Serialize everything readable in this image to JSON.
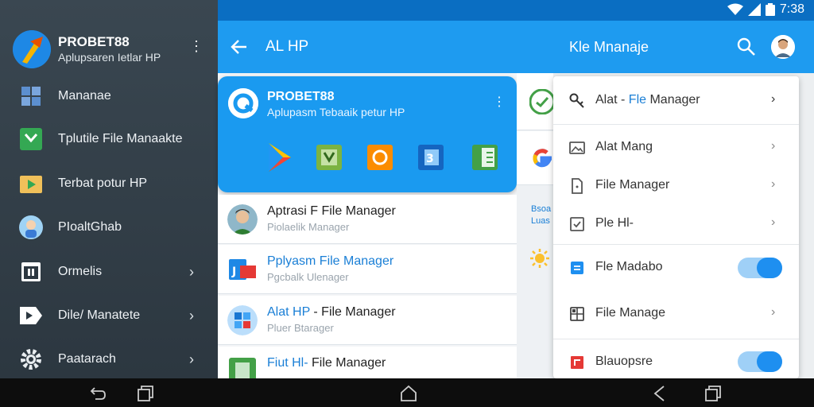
{
  "status_bar": {
    "time": "7:38"
  },
  "drawer": {
    "title": "PROBET88",
    "subtitle": "Aplupsaren Ietlar HP",
    "items": [
      {
        "label": "Mananae",
        "icon": "grid-icon",
        "chevron": false
      },
      {
        "label": "Tplutile File Manaakte",
        "icon": "green-app-icon",
        "chevron": false
      },
      {
        "label": "Terbat potur HP",
        "icon": "play-folder-icon",
        "chevron": false
      },
      {
        "label": "PIoaltGhab",
        "icon": "character-avatar-icon",
        "chevron": false
      },
      {
        "label": "Ormelis",
        "icon": "window-icon",
        "chevron": true
      },
      {
        "label": "Dile/ Manatete",
        "icon": "play-label-icon",
        "chevron": true
      },
      {
        "label": "Paatarach",
        "icon": "gear-icon",
        "chevron": true
      }
    ]
  },
  "appbar": {
    "title": "AL HP",
    "right_title": "Kle Mnanaje"
  },
  "app_card": {
    "title": "PROBET88",
    "subtitle": "Aplupasm Tebaaik petur HP"
  },
  "list": [
    {
      "title": "Aptrasi F File Manager",
      "title_accent": "",
      "subtitle": "Piolaelik Manager",
      "icon": "person-avatar-icon"
    },
    {
      "title": "Pplyasm File Manager",
      "title_accent": "all",
      "subtitle": "Pgcbalk Ulenager",
      "icon": "blue-red-app-icon"
    },
    {
      "title": "Alat HP - File Manager",
      "title_accent": "prefix",
      "subtitle": "Pluer Btarager",
      "icon": "windows-app-icon"
    },
    {
      "title": "Fiut Hl- File Manager",
      "title_accent": "prefix",
      "subtitle": "",
      "icon": "green-doc-icon"
    }
  ],
  "strip": {
    "text_line1": "Bsoa",
    "text_line2": "Luas"
  },
  "menu": {
    "header": {
      "prefix": "Alat - ",
      "accent": "Fle",
      "suffix": " Manager"
    },
    "items": [
      {
        "label": "Alat Mang",
        "icon": "image-icon",
        "control": "chevron"
      },
      {
        "label": "File Manager",
        "icon": "doc-icon",
        "control": "chevron"
      },
      {
        "label": "Ple Hl-",
        "icon": "check-square-icon",
        "control": "chevron"
      },
      {
        "label": "Fle Madabo",
        "icon": "blue-doc-icon",
        "control": "toggle",
        "on": true
      },
      {
        "label": "File Manage",
        "icon": "grid-square-icon",
        "control": "chevron"
      },
      {
        "label": "Blauopsre",
        "icon": "red-square-icon",
        "control": "toggle",
        "on": true
      }
    ]
  },
  "colors": {
    "accent": "#1e9bf0",
    "drawer_bg": "#34414b",
    "status_bar": "#0a6ec2"
  }
}
